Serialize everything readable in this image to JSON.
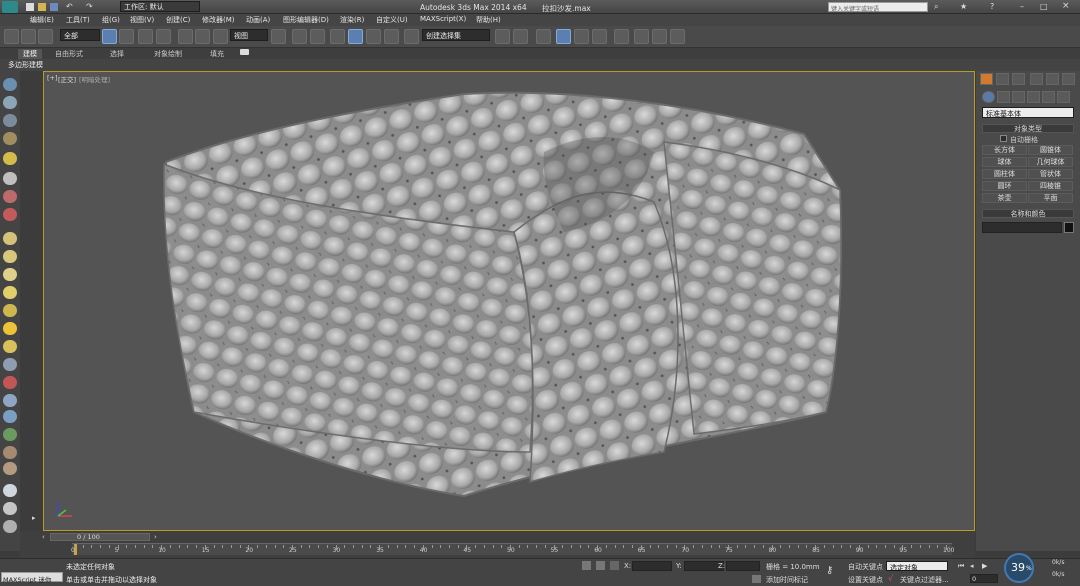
{
  "titlebar": {
    "workspace_label": "工作区: 默认",
    "app_title": "Autodesk 3ds Max  2014 x64",
    "file_name": "拉扣沙发.max",
    "search_placeholder": "键入关键字或短语"
  },
  "menu": {
    "items": [
      "编辑(E)",
      "工具(T)",
      "组(G)",
      "视图(V)",
      "创建(C)",
      "修改器(M)",
      "动画(A)",
      "图形编辑器(D)",
      "渲染(R)",
      "自定义(U)",
      "MAXScript(X)",
      "帮助(H)"
    ]
  },
  "toolbar": {
    "selection_filter": "全部",
    "reference_coord": "视图",
    "named_selection": "创建选择集"
  },
  "ribbon": {
    "tabs": [
      "建模",
      "自由形式",
      "选择",
      "对象绘制",
      "填充"
    ],
    "sub_label": "多边形建模"
  },
  "viewport": {
    "label_plus": "[+]",
    "label_view": "[正交]",
    "label_shading": "[明暗处理]",
    "background_color": "#545454",
    "border_color": "#b89c20",
    "object_color": "#b7b7b7"
  },
  "command_panel": {
    "category_dropdown": "标准基本体",
    "object_type_title": "对象类型",
    "autogrid_label": "自动栅格",
    "object_buttons": [
      "长方体",
      "圆锥体",
      "球体",
      "几何球体",
      "圆柱体",
      "管状体",
      "圆环",
      "四棱锥",
      "茶壶",
      "平面"
    ],
    "name_color_title": "名称和颜色",
    "name_color_swatch": "#111111"
  },
  "timeline": {
    "frame_label": "0 / 100",
    "ticks": [
      0,
      5,
      10,
      15,
      20,
      25,
      30,
      35,
      40,
      45,
      50,
      55,
      60,
      65,
      70,
      75,
      80,
      85,
      90,
      95,
      100
    ]
  },
  "status": {
    "maxscript_label": "MAXScript 迷你",
    "message1": "未选定任何对象",
    "message2": "单击或单击并拖动以选择对象",
    "x_label": "X:",
    "y_label": "Y:",
    "z_label": "Z:",
    "grid_label": "栅格 = 10.0mm",
    "add_time_tag": "添加时间标记",
    "auto_key": "自动关键点",
    "set_key": "设置关键点",
    "key_mode_dropdown": "选定对象",
    "key_filters": "关键点过滤器...",
    "frame_value": "0",
    "fps_value": "39",
    "fps_unit": "%",
    "net_up": "0k/s",
    "net_down": "0k/s"
  }
}
